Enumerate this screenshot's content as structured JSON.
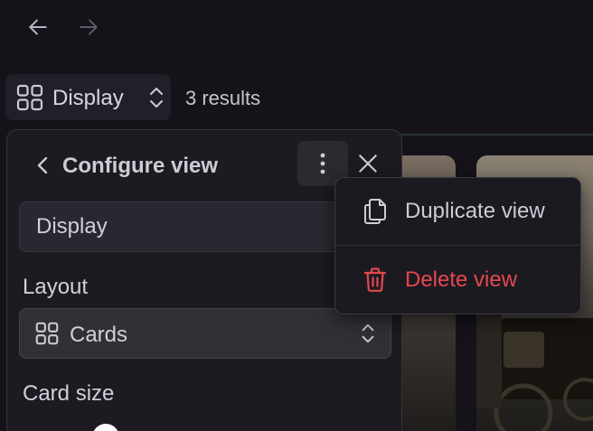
{
  "toolbar": {
    "view_name": "Display",
    "results_label": "3 results"
  },
  "panel": {
    "title": "Configure view",
    "name_value": "Display",
    "layout_label": "Layout",
    "layout_value": "Cards",
    "card_size_label": "Card size"
  },
  "menu": {
    "duplicate_label": "Duplicate view",
    "delete_label": "Delete view"
  },
  "icons": {
    "back": "arrow-left-icon",
    "forward": "arrow-right-icon",
    "grid": "grid-icon",
    "updown": "chevron-updown-icon",
    "more": "more-vertical-icon",
    "close": "close-icon",
    "copy": "copy-icon",
    "trash": "trash-icon"
  },
  "colors": {
    "background": "#15121a",
    "panel": "#1d1a22",
    "danger": "#e5484d",
    "text": "#d9d6de"
  }
}
